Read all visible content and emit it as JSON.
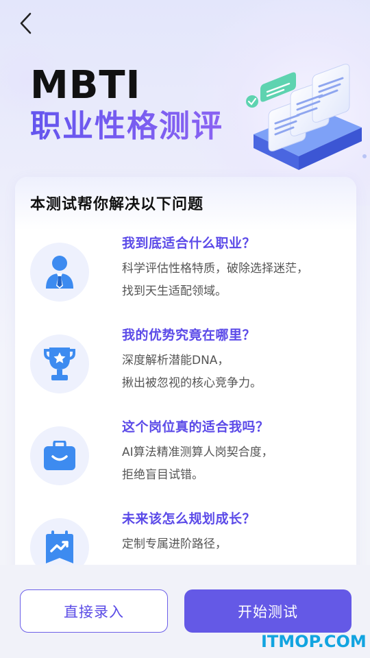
{
  "header": {
    "back_icon": "chevron-left-icon",
    "title_en": "MBTI",
    "title_zh": "职业性格测评"
  },
  "card": {
    "title": "本测试帮你解决以下问题",
    "items": [
      {
        "icon": "person-tie-icon",
        "question": "我到底适合什么职业？",
        "lines": [
          "科学评估性格特质，破除选择迷茫，",
          "找到天生适配领域。"
        ]
      },
      {
        "icon": "trophy-star-icon",
        "question": "我的优势究竟在哪里？",
        "lines": [
          "深度解析潜能DNA，",
          "揪出被忽视的核心竞争力。"
        ]
      },
      {
        "icon": "briefcase-icon",
        "question": "这个岗位真的适合我吗？",
        "lines": [
          "AI算法精准测算人岗契合度，",
          "拒绝盲目试错。"
        ]
      },
      {
        "icon": "growth-calendar-icon",
        "question": "未来该怎么规划成长？",
        "lines": [
          "定制专属进阶路径，",
          ""
        ]
      }
    ]
  },
  "actions": {
    "secondary_label": "直接录入",
    "primary_label": "开始测试"
  },
  "watermark": "ITMOP.COM",
  "colors": {
    "accent": "#6459e6",
    "question_text": "#5b4ae8",
    "icon_blue": "#3d8bf0",
    "watermark": "#12a4e0"
  }
}
